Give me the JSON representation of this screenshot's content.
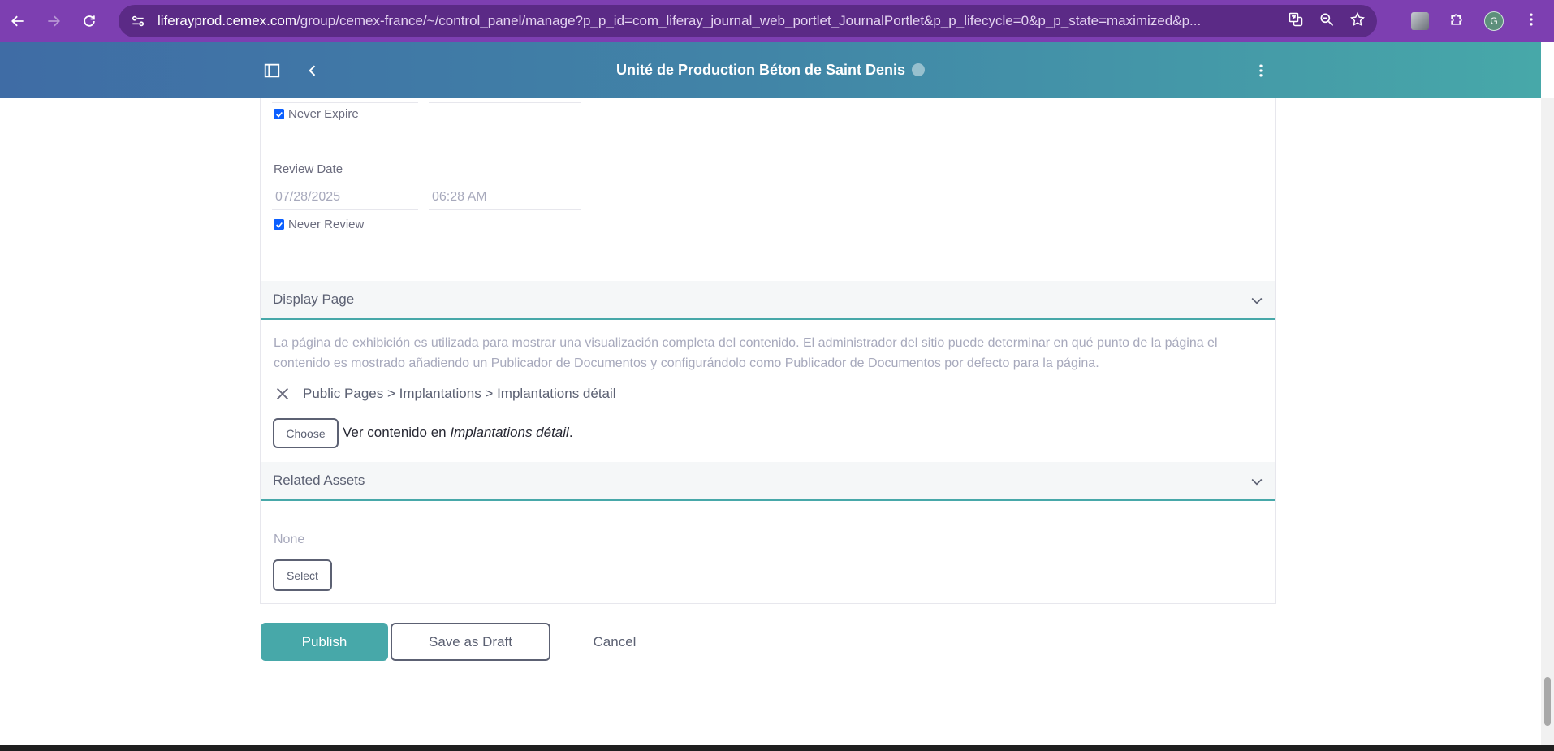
{
  "browser": {
    "url_host": "liferayprod.cemex.com",
    "url_path": "/group/cemex-france/~/control_panel/manage?p_p_id=com_liferay_journal_web_portlet_JournalPortlet&p_p_lifecycle=0&p_p_state=maximized&p...",
    "profile_initial": "G",
    "icons": [
      "back-arrow-icon",
      "forward-arrow-icon",
      "reload-icon",
      "site-settings-icon",
      "translate-icon",
      "zoom-icon",
      "star-icon",
      "extension-icon",
      "puzzle-icon",
      "more-vert-icon"
    ]
  },
  "header": {
    "title": "Unité de Production Béton de Saint Denis",
    "icons": [
      "sidebar-toggle-icon",
      "back-chevron-icon",
      "help-icon",
      "kebab-menu-icon"
    ]
  },
  "schedule": {
    "never_expire_label": "Never Expire",
    "never_expire_checked": true,
    "review_date_label": "Review Date",
    "review_date_value": "07/28/2025",
    "review_time_value": "06:28 AM",
    "never_review_label": "Never Review",
    "never_review_checked": true
  },
  "display_page": {
    "title": "Display Page",
    "description": "La página de exhibición es utilizada para mostrar una visualización completa del contenido. El administrador del sitio puede determinar en qué punto de la página el contenido es mostrado añadiendo un Publicador de Documentos y configurándolo como Publicador de Documentos por defecto para la página.",
    "selected_path": "Public Pages > Implantations > Implantations détail",
    "choose_label": "Choose",
    "view_prefix": "Ver contenido en ",
    "view_page": "Implantations détail",
    "view_suffix": "."
  },
  "related_assets": {
    "title": "Related Assets",
    "empty_text": "None",
    "select_label": "Select"
  },
  "actions": {
    "publish_label": "Publish",
    "save_draft_label": "Save as Draft",
    "cancel_label": "Cancel"
  },
  "colors": {
    "browser_chrome": "#7d3fb1",
    "header_gradient_start": "#3f6ca5",
    "header_gradient_end": "#47a8a9",
    "primary": "#47a8a9",
    "checkbox": "#0b5fff"
  }
}
